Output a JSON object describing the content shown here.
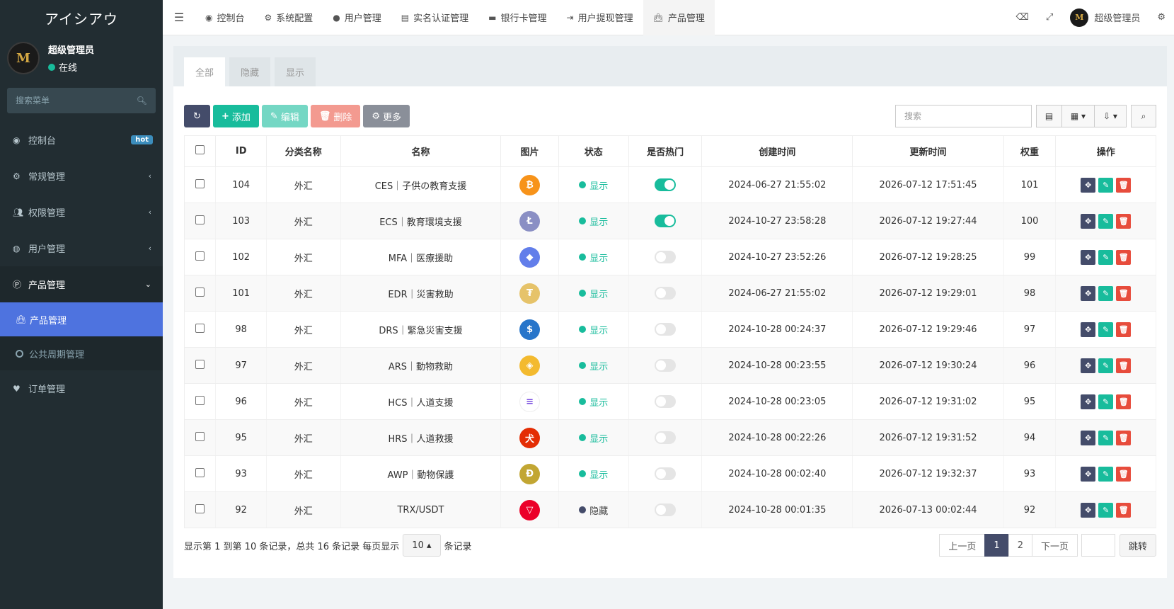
{
  "sidebar": {
    "brand": "アイシアウ",
    "user": {
      "name": "超级管理员",
      "status": "在线"
    },
    "search_placeholder": "搜索菜单",
    "items": [
      {
        "label": "控制台",
        "icon": "dashboard-icon",
        "badge": "hot"
      },
      {
        "label": "常规管理",
        "icon": "cogs-icon"
      },
      {
        "label": "权限管理",
        "icon": "group-icon"
      },
      {
        "label": "用户管理",
        "icon": "user-circle-icon"
      },
      {
        "label": "产品管理",
        "icon": "product-p-icon"
      },
      {
        "label": "订单管理",
        "icon": "heartbeat-icon"
      }
    ],
    "submenu": [
      {
        "label": "产品管理",
        "icon": "shopping-bag-icon"
      },
      {
        "label": "公共周期管理",
        "icon": "circle-o-icon"
      }
    ]
  },
  "navbar": {
    "tabs": [
      {
        "label": "控制台",
        "icon": "dashboard-icon"
      },
      {
        "label": "系统配置",
        "icon": "gear-icon"
      },
      {
        "label": "用户管理",
        "icon": "user-icon"
      },
      {
        "label": "实名认证管理",
        "icon": "id-card-icon"
      },
      {
        "label": "银行卡管理",
        "icon": "credit-card-icon"
      },
      {
        "label": "用户提现管理",
        "icon": "sign-out-icon"
      },
      {
        "label": "产品管理",
        "icon": "shopping-bag-icon"
      }
    ],
    "admin_name": "超级管理员"
  },
  "panel": {
    "tabs": [
      "全部",
      "隐藏",
      "显示"
    ],
    "toolbar": {
      "add": "添加",
      "edit": "编辑",
      "delete": "删除",
      "more": "更多",
      "search_placeholder": "搜索"
    },
    "columns": [
      "ID",
      "分类名称",
      "名称",
      "图片",
      "状态",
      "是否热门",
      "创建时间",
      "更新时间",
      "权重",
      "操作"
    ],
    "rows": [
      {
        "id": "104",
        "category": "外汇",
        "name": "CES｜子供の教育支援",
        "coin": "bitcoin-icon",
        "coin_color": "#f7931a",
        "glyph": "₿",
        "status": "显示",
        "hot": true,
        "created": "2024-06-27 21:55:02",
        "updated": "2026-07-12 17:51:45",
        "weight": "101"
      },
      {
        "id": "103",
        "category": "外汇",
        "name": "ECS｜教育環境支援",
        "coin": "litecoin-icon",
        "coin_color": "#8a8fc4",
        "glyph": "Ł",
        "status": "显示",
        "hot": true,
        "created": "2024-10-27 23:58:28",
        "updated": "2026-07-12 19:27:44",
        "weight": "100"
      },
      {
        "id": "102",
        "category": "外汇",
        "name": "MFA｜医療援助",
        "coin": "ethereum-icon",
        "coin_color": "#627eea",
        "glyph": "◆",
        "status": "显示",
        "hot": false,
        "created": "2024-10-27 23:52:26",
        "updated": "2026-07-12 19:28:25",
        "weight": "99"
      },
      {
        "id": "101",
        "category": "外汇",
        "name": "EDR｜災害救助",
        "coin": "tether-gold-icon",
        "coin_color": "#e6c36a",
        "glyph": "₮",
        "status": "显示",
        "hot": false,
        "created": "2024-06-27 21:55:02",
        "updated": "2026-07-12 19:29:01",
        "weight": "98"
      },
      {
        "id": "98",
        "category": "外汇",
        "name": "DRS｜緊急災害支援",
        "coin": "usd-coin-icon",
        "coin_color": "#2775ca",
        "glyph": "$",
        "status": "显示",
        "hot": false,
        "created": "2024-10-28 00:24:37",
        "updated": "2026-07-12 19:29:46",
        "weight": "97"
      },
      {
        "id": "97",
        "category": "外汇",
        "name": "ARS｜動物救助",
        "coin": "binance-icon",
        "coin_color": "#f3ba2f",
        "glyph": "◈",
        "status": "显示",
        "hot": false,
        "created": "2024-10-28 00:23:55",
        "updated": "2026-07-12 19:30:24",
        "weight": "96"
      },
      {
        "id": "96",
        "category": "外汇",
        "name": "HCS｜人道支援",
        "coin": "solana-icon",
        "coin_color": "#ffffff",
        "glyph": "≡",
        "status": "显示",
        "hot": false,
        "created": "2024-10-28 00:23:05",
        "updated": "2026-07-12 19:31:02",
        "weight": "95"
      },
      {
        "id": "95",
        "category": "外汇",
        "name": "HRS｜人道救援",
        "coin": "shiba-icon",
        "coin_color": "#e42d04",
        "glyph": "犬",
        "status": "显示",
        "hot": false,
        "created": "2024-10-28 00:22:26",
        "updated": "2026-07-12 19:31:52",
        "weight": "94"
      },
      {
        "id": "93",
        "category": "外汇",
        "name": "AWP｜動物保護",
        "coin": "dogecoin-icon",
        "coin_color": "#c2a633",
        "glyph": "Ð",
        "status": "显示",
        "hot": false,
        "created": "2024-10-28 00:02:40",
        "updated": "2026-07-12 19:32:37",
        "weight": "93"
      },
      {
        "id": "92",
        "category": "外汇",
        "name": "TRX/USDT",
        "coin": "tron-icon",
        "coin_color": "#eb0029",
        "glyph": "▽",
        "status": "隐藏",
        "hot": false,
        "created": "2024-10-28 00:01:35",
        "updated": "2026-07-13 00:02:44",
        "weight": "92"
      }
    ],
    "footer": {
      "summary": "显示第 1 到第 10 条记录，总共 16 条记录 每页显示",
      "page_size": "10",
      "suffix": "条记录",
      "prev": "上一页",
      "pages": [
        "1",
        "2"
      ],
      "next": "下一页",
      "go": "跳转"
    }
  }
}
